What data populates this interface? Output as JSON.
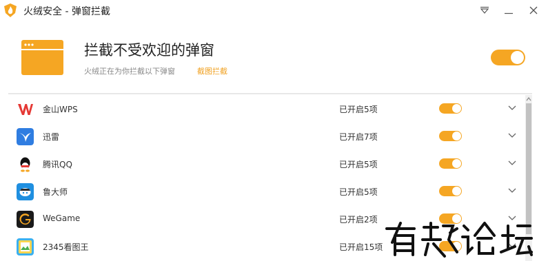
{
  "window": {
    "title": "火绒安全 - 弹窗拦截",
    "accent_color": "#f5a623"
  },
  "header": {
    "title": "拦截不受欢迎的弹窗",
    "subtitle": "火绒正在为你拦截以下弹窗",
    "link": "截图拦截",
    "master_toggle_on": true
  },
  "apps": [
    {
      "name": "金山WPS",
      "count": "已开启5项",
      "icon": "wps-icon",
      "enabled": true
    },
    {
      "name": "迅雷",
      "count": "已开启7项",
      "icon": "thunder-icon",
      "enabled": true
    },
    {
      "name": "腾讯QQ",
      "count": "已开启5项",
      "icon": "qq-icon",
      "enabled": true
    },
    {
      "name": "鲁大师",
      "count": "已开启5项",
      "icon": "ludashi-icon",
      "enabled": true
    },
    {
      "name": "WeGame",
      "count": "已开启2项",
      "icon": "wegame-icon",
      "enabled": true
    },
    {
      "name": "2345看图王",
      "count": "已开启15项",
      "icon": "2345-icon",
      "enabled": true
    }
  ]
}
